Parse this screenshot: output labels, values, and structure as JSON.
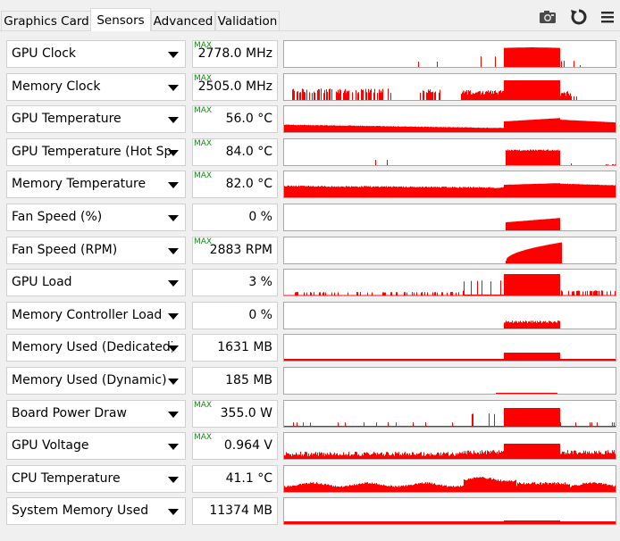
{
  "tabs": [
    {
      "label": "Graphics Card",
      "active": false
    },
    {
      "label": "Sensors",
      "active": true
    },
    {
      "label": "Advanced",
      "active": false
    },
    {
      "label": "Validation",
      "active": false
    }
  ],
  "toolbar": {
    "screenshot_icon": "camera-icon",
    "refresh_icon": "refresh-icon",
    "menu_icon": "hamburger-menu-icon"
  },
  "colors": {
    "graph_fill": "#ff0000",
    "max_tag": "#0a8f0a"
  },
  "sensors": [
    {
      "name": "GPU Clock",
      "value": "2778.0 MHz",
      "max": "MAX",
      "fill_fraction": 0.95
    },
    {
      "name": "Memory Clock",
      "value": "2505.0 MHz",
      "max": "MAX",
      "fill_fraction": 0.95
    },
    {
      "name": "GPU Temperature",
      "value": "56.0 °C",
      "max": "MAX",
      "fill_fraction": 0.2
    },
    {
      "name": "GPU Temperature (Hot Spot)",
      "value": "84.0 °C",
      "max": "MAX",
      "fill_fraction": 0.85
    },
    {
      "name": "Memory Temperature",
      "value": "82.0 °C",
      "max": "MAX",
      "fill_fraction": 0.2
    },
    {
      "name": "Fan Speed (%)",
      "value": "0 %",
      "max": "",
      "fill_fraction": 0.0
    },
    {
      "name": "Fan Speed (RPM)",
      "value": "2883 RPM",
      "max": "MAX",
      "fill_fraction": 1.0
    },
    {
      "name": "GPU Load",
      "value": "3 %",
      "max": "",
      "fill_fraction": 0.04
    },
    {
      "name": "Memory Controller Load",
      "value": "0 %",
      "max": "",
      "fill_fraction": 0.0
    },
    {
      "name": "Memory Used (Dedicated)",
      "value": "1631 MB",
      "max": "",
      "fill_fraction": 0.1
    },
    {
      "name": "Memory Used (Dynamic)",
      "value": "185 MB",
      "max": "",
      "fill_fraction": 0.0
    },
    {
      "name": "Board Power Draw",
      "value": "355.0 W",
      "max": "MAX",
      "fill_fraction": 0.95
    },
    {
      "name": "GPU Voltage",
      "value": "0.964 V",
      "max": "MAX",
      "fill_fraction": 0.2
    },
    {
      "name": "CPU Temperature",
      "value": "41.1 °C",
      "max": "",
      "fill_fraction": 0.3
    },
    {
      "name": "System Memory Used",
      "value": "11374 MB",
      "max": "",
      "fill_fraction": 0.35
    }
  ]
}
